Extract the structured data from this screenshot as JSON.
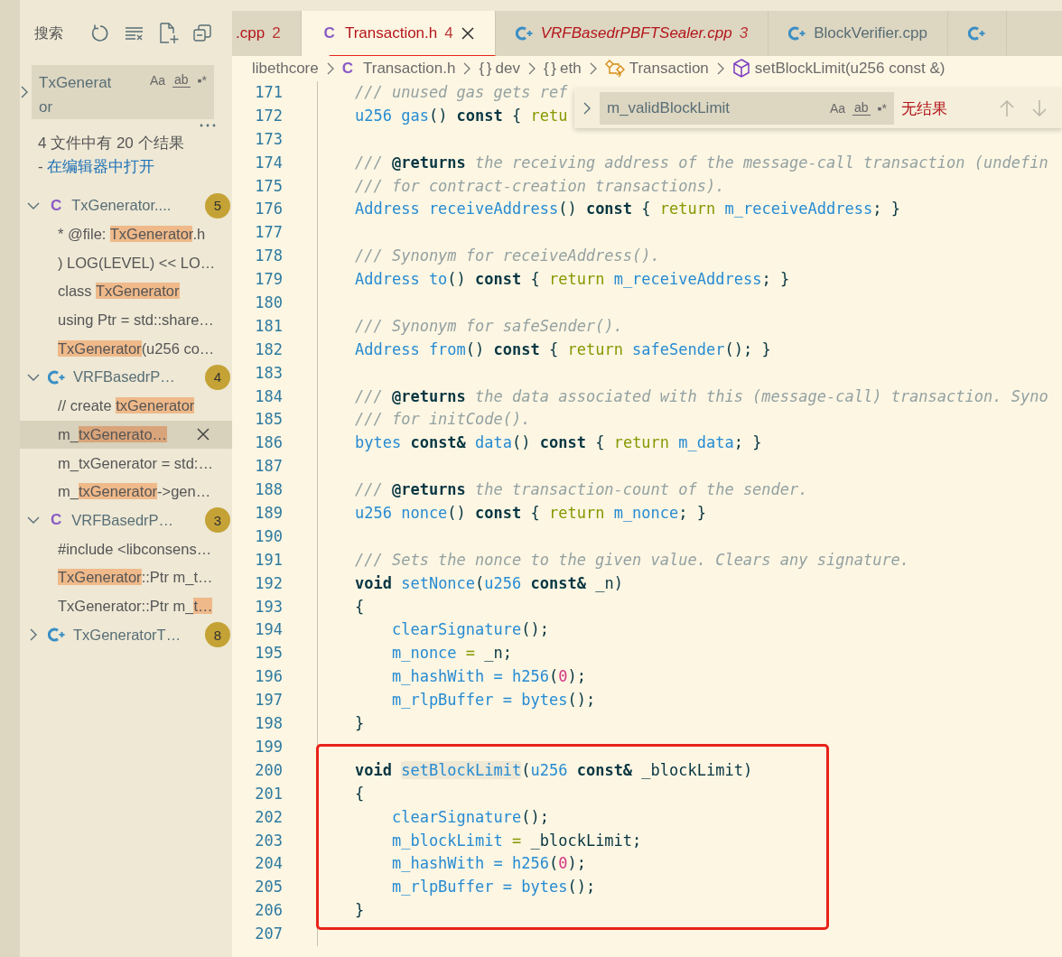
{
  "sidebar": {
    "title": "搜索",
    "search": {
      "value": "TxGenerator",
      "options": [
        "Aa",
        "ab",
        "▪*"
      ]
    },
    "summary": "4 文件中有 20 个结果",
    "separator": "-",
    "open_link": "在编辑器中打开",
    "results": [
      {
        "kind": "c",
        "icon": "C",
        "name": "TxGenerator....",
        "count": "5",
        "expanded": true,
        "matches": [
          {
            "selected": false,
            "segments": [
              {
                "text": "* @file: ",
                "match": false
              },
              {
                "text": "TxGenerator",
                "match": true
              },
              {
                "text": ".h",
                "match": false
              }
            ]
          },
          {
            "selected": false,
            "segments": [
              {
                "text": ") LOG(LEVEL) << LO…",
                "match": false
              }
            ]
          },
          {
            "selected": false,
            "segments": [
              {
                "text": "class ",
                "match": false
              },
              {
                "text": "TxGenerator",
                "match": true
              }
            ]
          },
          {
            "selected": false,
            "segments": [
              {
                "text": "using Ptr = std::share…",
                "match": false
              }
            ]
          },
          {
            "selected": false,
            "segments": [
              {
                "text": "TxGenerator",
                "match": true
              },
              {
                "text": "(u256 co…",
                "match": false
              }
            ]
          }
        ]
      },
      {
        "kind": "cpp",
        "name": "VRFBasedrP…",
        "count": "4",
        "expanded": true,
        "matches": [
          {
            "selected": false,
            "segments": [
              {
                "text": "// create ",
                "match": false
              },
              {
                "text": "txGenerator",
                "match": true
              }
            ]
          },
          {
            "selected": true,
            "segments": [
              {
                "text": "m_",
                "match": false
              },
              {
                "text": "txGenerato…",
                "match": true
              }
            ]
          },
          {
            "selected": false,
            "segments": [
              {
                "text": "m_txGenerator = std:…",
                "match": false
              }
            ]
          },
          {
            "selected": false,
            "segments": [
              {
                "text": "m_",
                "match": false
              },
              {
                "text": "txGenerator",
                "match": true
              },
              {
                "text": "->gen…",
                "match": false
              }
            ]
          }
        ]
      },
      {
        "kind": "c",
        "icon": "C",
        "name": "VRFBasedrP…",
        "count": "3",
        "expanded": true,
        "matches": [
          {
            "selected": false,
            "segments": [
              {
                "text": "#include <libconsens…",
                "match": false
              }
            ]
          },
          {
            "selected": false,
            "segments": [
              {
                "text": "TxGenerator",
                "match": true
              },
              {
                "text": "::Ptr m_t…",
                "match": false
              }
            ]
          },
          {
            "selected": false,
            "segments": [
              {
                "text": "TxGenerator::Ptr m_",
                "match": false
              },
              {
                "text": "t…",
                "match": true
              }
            ]
          }
        ]
      },
      {
        "kind": "cpp",
        "name": "TxGeneratorT…",
        "count": "8",
        "expanded": false
      }
    ]
  },
  "tabs": [
    {
      "kind": "none",
      "label": ".cpp",
      "count": "2",
      "selected": false,
      "errors": true,
      "preview": false
    },
    {
      "kind": "c",
      "icon": "C",
      "label": "Transaction.h",
      "count": "4",
      "selected": true,
      "errors": true,
      "preview": false
    },
    {
      "kind": "cpp",
      "label": "VRFBasedrPBFTSealer.cpp",
      "count": "3",
      "selected": false,
      "errors": true,
      "preview": true
    },
    {
      "kind": "cpp",
      "label": "BlockVerifier.cpp",
      "selected": false,
      "errors": false,
      "preview": false
    },
    {
      "kind": "cpp",
      "selected": false
    }
  ],
  "breadcrumb": [
    {
      "kind": "folder",
      "label": "libethcore"
    },
    {
      "kind": "file",
      "icon": "C",
      "label": "Transaction.h"
    },
    {
      "kind": "namespace",
      "icon": "{ }",
      "label": "dev"
    },
    {
      "kind": "namespace",
      "icon": "{ }",
      "label": "eth"
    },
    {
      "kind": "class",
      "label": "Transaction"
    },
    {
      "kind": "method",
      "label": "setBlockLimit(u256 const &)"
    }
  ],
  "find": {
    "value": "m_validBlockLimit",
    "options": [
      "Aa",
      "ab",
      "▪*"
    ],
    "result": "无结果"
  },
  "lines": [
    {
      "number": "171",
      "tokens": [
        {
          "kind": "comment",
          "text": "/// unused gas gets ref"
        }
      ]
    },
    {
      "number": "172",
      "tokens": [
        {
          "kind": "name",
          "text": "u256 gas"
        },
        {
          "kind": "plain",
          "text": "() "
        },
        {
          "kind": "keyword",
          "text": "const"
        },
        {
          "kind": "plain",
          "text": " { "
        },
        {
          "kind": "control",
          "text": "retu"
        }
      ]
    },
    {
      "number": "173"
    },
    {
      "number": "174",
      "tokens": [
        {
          "kind": "comment",
          "text": "/// "
        },
        {
          "kind": "doctag",
          "text": "@returns"
        },
        {
          "kind": "comment",
          "text": " the receiving address of the message-call transaction (undefin"
        }
      ]
    },
    {
      "number": "175",
      "tokens": [
        {
          "kind": "comment",
          "text": "/// for contract-creation transactions)."
        }
      ]
    },
    {
      "number": "176",
      "tokens": [
        {
          "kind": "name",
          "text": "Address receiveAddress"
        },
        {
          "kind": "plain",
          "text": "() "
        },
        {
          "kind": "keyword",
          "text": "const"
        },
        {
          "kind": "plain",
          "text": " { "
        },
        {
          "kind": "control",
          "text": "return"
        },
        {
          "kind": "name",
          "text": " m_receiveAddress"
        },
        {
          "kind": "plain",
          "text": "; }"
        }
      ]
    },
    {
      "number": "177"
    },
    {
      "number": "178",
      "tokens": [
        {
          "kind": "comment",
          "text": "/// Synonym for receiveAddress()."
        }
      ]
    },
    {
      "number": "179",
      "tokens": [
        {
          "kind": "name",
          "text": "Address to"
        },
        {
          "kind": "plain",
          "text": "() "
        },
        {
          "kind": "keyword",
          "text": "const"
        },
        {
          "kind": "plain",
          "text": " { "
        },
        {
          "kind": "control",
          "text": "return"
        },
        {
          "kind": "name",
          "text": " m_receiveAddress"
        },
        {
          "kind": "plain",
          "text": "; }"
        }
      ]
    },
    {
      "number": "180"
    },
    {
      "number": "181",
      "tokens": [
        {
          "kind": "comment",
          "text": "/// Synonym for safeSender()."
        }
      ]
    },
    {
      "number": "182",
      "tokens": [
        {
          "kind": "name",
          "text": "Address from"
        },
        {
          "kind": "plain",
          "text": "() "
        },
        {
          "kind": "keyword",
          "text": "const"
        },
        {
          "kind": "plain",
          "text": " { "
        },
        {
          "kind": "control",
          "text": "return"
        },
        {
          "kind": "name",
          "text": " safeSender"
        },
        {
          "kind": "plain",
          "text": "(); }"
        }
      ]
    },
    {
      "number": "183"
    },
    {
      "number": "184",
      "tokens": [
        {
          "kind": "comment",
          "text": "/// "
        },
        {
          "kind": "doctag",
          "text": "@returns"
        },
        {
          "kind": "comment",
          "text": " the data associated with this (message-call) transaction. Syno"
        }
      ]
    },
    {
      "number": "185",
      "tokens": [
        {
          "kind": "comment",
          "text": "/// for initCode()."
        }
      ]
    },
    {
      "number": "186",
      "tokens": [
        {
          "kind": "name",
          "text": "bytes"
        },
        {
          "kind": "keyword",
          "text": " const&"
        },
        {
          "kind": "name",
          "text": " data"
        },
        {
          "kind": "plain",
          "text": "() "
        },
        {
          "kind": "keyword",
          "text": "const"
        },
        {
          "kind": "plain",
          "text": " { "
        },
        {
          "kind": "control",
          "text": "return"
        },
        {
          "kind": "name",
          "text": " m_data"
        },
        {
          "kind": "plain",
          "text": "; }"
        }
      ]
    },
    {
      "number": "187"
    },
    {
      "number": "188",
      "tokens": [
        {
          "kind": "comment",
          "text": "/// "
        },
        {
          "kind": "doctag",
          "text": "@returns"
        },
        {
          "kind": "comment",
          "text": " the transaction-count of the sender."
        }
      ]
    },
    {
      "number": "189",
      "tokens": [
        {
          "kind": "name",
          "text": "u256 nonce"
        },
        {
          "kind": "plain",
          "text": "() "
        },
        {
          "kind": "keyword",
          "text": "const"
        },
        {
          "kind": "plain",
          "text": " { "
        },
        {
          "kind": "control",
          "text": "return"
        },
        {
          "kind": "name",
          "text": " m_nonce"
        },
        {
          "kind": "plain",
          "text": "; }"
        }
      ]
    },
    {
      "number": "190"
    },
    {
      "number": "191",
      "tokens": [
        {
          "kind": "comment",
          "text": "/// Sets the nonce to the given value. Clears any signature."
        }
      ]
    },
    {
      "number": "192",
      "tokens": [
        {
          "kind": "keyword",
          "text": "void"
        },
        {
          "kind": "name",
          "text": " setNonce"
        },
        {
          "kind": "plain",
          "text": "("
        },
        {
          "kind": "name",
          "text": "u256"
        },
        {
          "kind": "keyword",
          "text": " const&"
        },
        {
          "kind": "plain",
          "text": " _n)"
        }
      ]
    },
    {
      "number": "193",
      "tokens": [
        {
          "kind": "plain",
          "text": "{"
        }
      ]
    },
    {
      "number": "194",
      "tokens": [
        {
          "kind": "name",
          "text": "    clearSignature"
        },
        {
          "kind": "plain",
          "text": "();"
        }
      ]
    },
    {
      "number": "195",
      "tokens": [
        {
          "kind": "name",
          "text": "    m_nonce"
        },
        {
          "kind": "control",
          "text": " ="
        },
        {
          "kind": "plain",
          "text": " _n;"
        }
      ]
    },
    {
      "number": "196",
      "tokens": [
        {
          "kind": "name",
          "text": "    m_hashWith = h256"
        },
        {
          "kind": "plain",
          "text": "("
        },
        {
          "kind": "number",
          "text": "0"
        },
        {
          "kind": "plain",
          "text": ");"
        }
      ]
    },
    {
      "number": "197",
      "tokens": [
        {
          "kind": "name",
          "text": "    m_rlpBuffer = bytes"
        },
        {
          "kind": "plain",
          "text": "();"
        }
      ]
    },
    {
      "number": "198",
      "tokens": [
        {
          "kind": "plain",
          "text": "}"
        }
      ]
    },
    {
      "number": "199"
    },
    {
      "number": "200",
      "tokens": [
        {
          "kind": "keyword",
          "text": "void "
        },
        {
          "kind": "selection",
          "text": "setBlockLimit"
        },
        {
          "kind": "plain",
          "text": "("
        },
        {
          "kind": "name",
          "text": "u256"
        },
        {
          "kind": "keyword",
          "text": " const&"
        },
        {
          "kind": "plain",
          "text": " _blockLimit)"
        }
      ]
    },
    {
      "number": "201",
      "tokens": [
        {
          "kind": "plain",
          "text": "{"
        }
      ]
    },
    {
      "number": "202",
      "tokens": [
        {
          "kind": "name",
          "text": "    clearSignature"
        },
        {
          "kind": "plain",
          "text": "();"
        }
      ]
    },
    {
      "number": "203",
      "tokens": [
        {
          "kind": "name",
          "text": "    m_blockLimit"
        },
        {
          "kind": "control",
          "text": " ="
        },
        {
          "kind": "plain",
          "text": " _blockLimit;"
        }
      ]
    },
    {
      "number": "204",
      "tokens": [
        {
          "kind": "name",
          "text": "    m_hashWith = h256"
        },
        {
          "kind": "plain",
          "text": "("
        },
        {
          "kind": "number",
          "text": "0"
        },
        {
          "kind": "plain",
          "text": ");"
        }
      ]
    },
    {
      "number": "205",
      "tokens": [
        {
          "kind": "name",
          "text": "    m_rlpBuffer = bytes"
        },
        {
          "kind": "plain",
          "text": "();"
        }
      ]
    },
    {
      "number": "206",
      "tokens": [
        {
          "kind": "plain",
          "text": "}"
        }
      ]
    },
    {
      "number": "207"
    }
  ]
}
